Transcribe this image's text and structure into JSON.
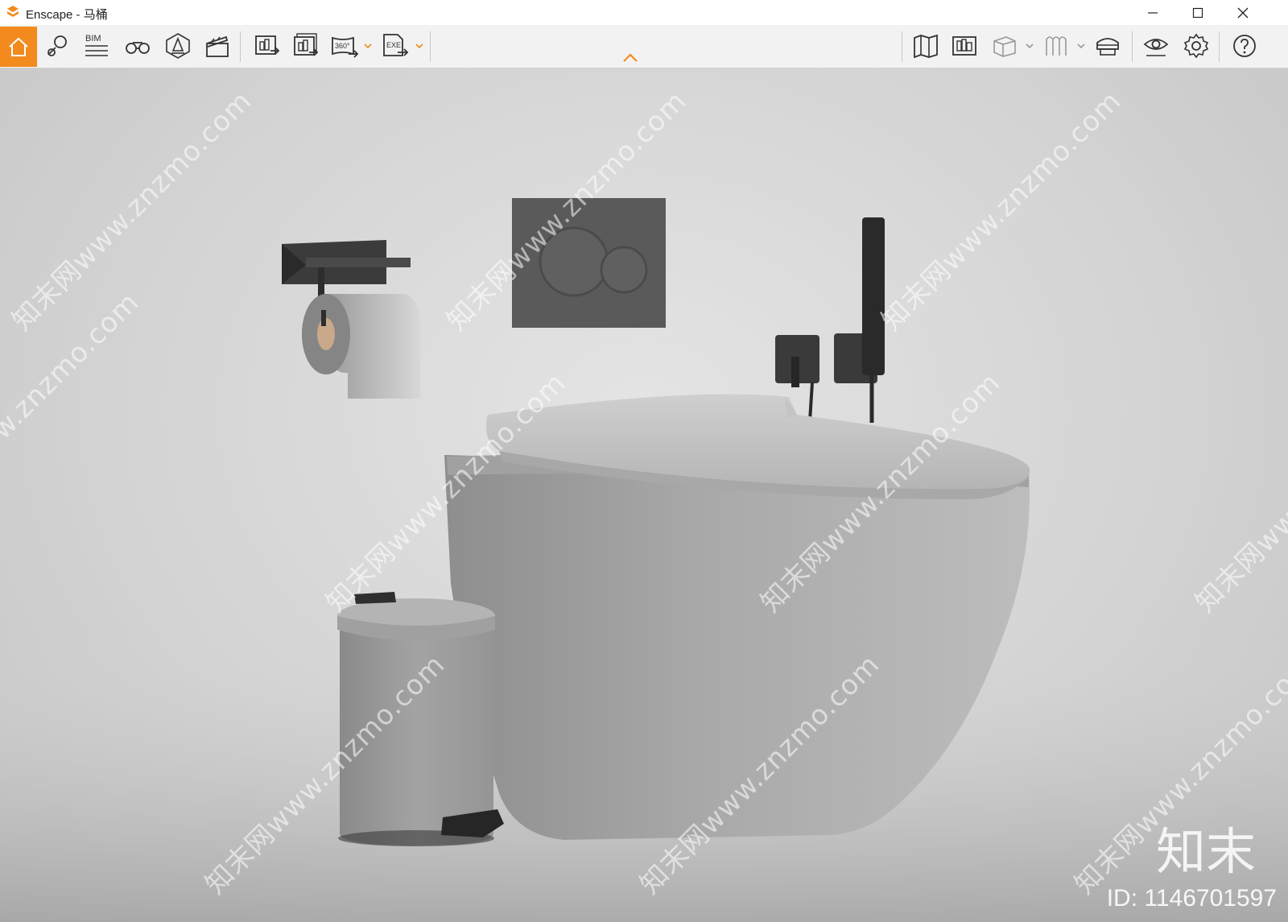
{
  "window": {
    "title": "Enscape - 马桶",
    "controls": {
      "minimize": "minimize-icon",
      "maximize": "maximize-icon",
      "close": "close-icon"
    }
  },
  "toolbar": {
    "accent_color": "#f28a1d",
    "left_tools": [
      {
        "name": "home-icon",
        "active": true
      },
      {
        "name": "map-pin-icon"
      },
      {
        "name": "bim-icon",
        "label": "BIM"
      },
      {
        "name": "binoculars-icon"
      },
      {
        "name": "light-view-icon"
      },
      {
        "name": "clapperboard-icon"
      },
      {
        "name": "export-image-icon"
      },
      {
        "name": "batch-export-icon"
      },
      {
        "name": "export-panorama-icon",
        "label": "360°"
      },
      {
        "name": "export-exe-icon",
        "label": "EXE"
      }
    ],
    "collapse_icon": "chevron-up-icon",
    "right_tools": [
      {
        "name": "map-icon"
      },
      {
        "name": "asset-library-icon"
      },
      {
        "name": "cube-icon"
      },
      {
        "name": "vr-headset-icon"
      },
      {
        "name": "eye-icon"
      },
      {
        "name": "gear-icon"
      },
      {
        "name": "help-icon"
      }
    ]
  },
  "viewport": {
    "scene": "toilet-render",
    "watermark_text": "知末网www.znzmo.com",
    "watermark_brand": "知末",
    "watermark_id": "ID: 1146701597"
  }
}
